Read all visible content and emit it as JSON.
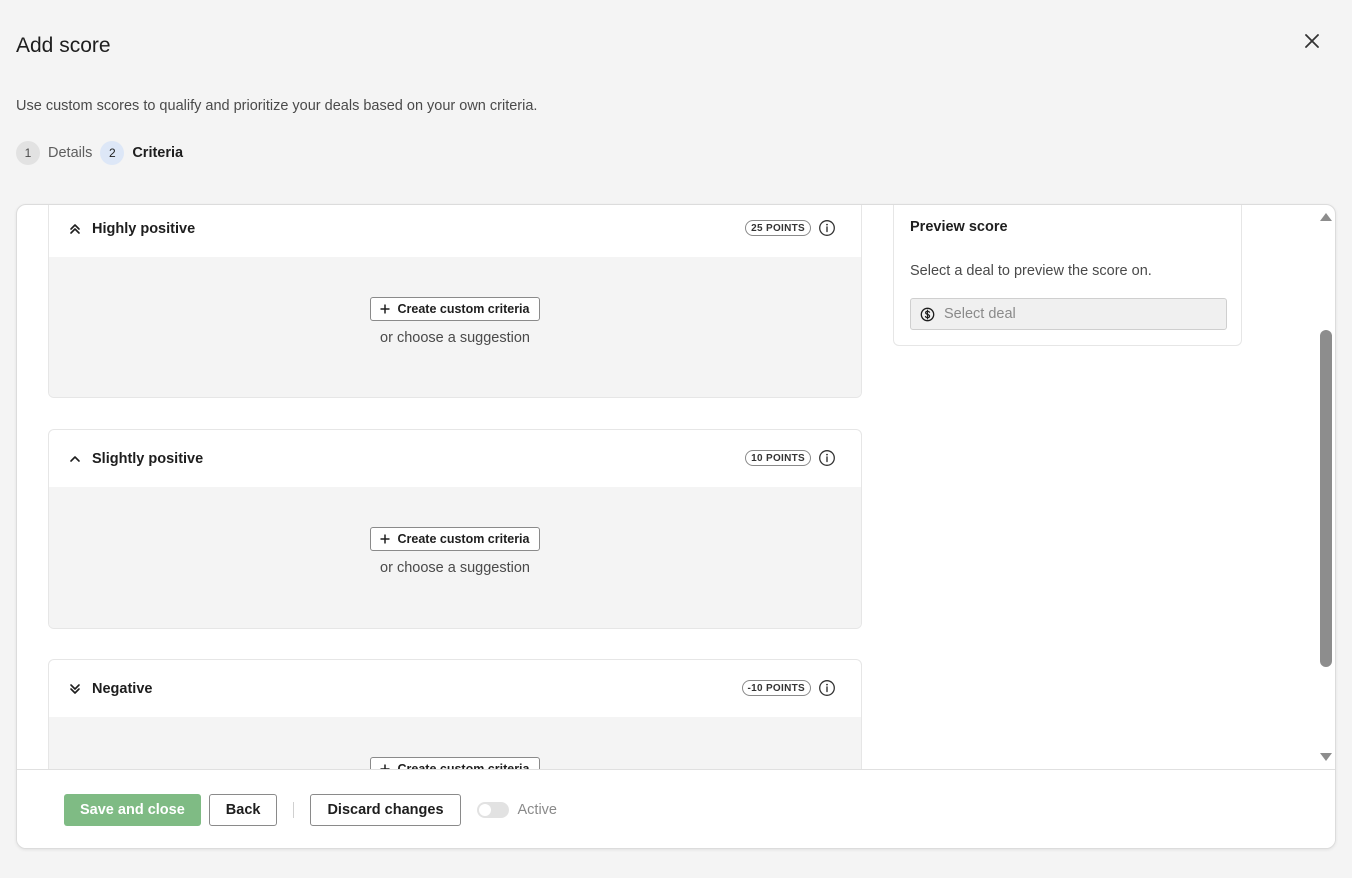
{
  "header": {
    "title": "Add score",
    "subtitle": "Use custom scores to qualify and prioritize your deals based on your own criteria."
  },
  "steps": [
    {
      "number": "1",
      "label": "Details",
      "state": "done"
    },
    {
      "number": "2",
      "label": "Criteria",
      "state": "current"
    }
  ],
  "criteria": {
    "create_label": "Create custom criteria",
    "suggestion_label": "or choose a suggestion",
    "cards": [
      {
        "title": "Highly positive",
        "points": "25 POINTS",
        "icon": "double-chevron-up-icon"
      },
      {
        "title": "Slightly positive",
        "points": "10 POINTS",
        "icon": "chevron-up-icon"
      },
      {
        "title": "Negative",
        "points": "-10 POINTS",
        "icon": "double-chevron-down-icon"
      }
    ]
  },
  "preview": {
    "title": "Preview score",
    "text": "Select a deal to preview the score on.",
    "select_placeholder": "Select deal"
  },
  "footer": {
    "save_label": "Save and close",
    "back_label": "Back",
    "discard_label": "Discard changes",
    "active_label": "Active",
    "active_on": false
  },
  "colors": {
    "primary": "#7fbb84",
    "background": "#f4f4f4",
    "scroll_thumb": "#8d8d8d"
  }
}
